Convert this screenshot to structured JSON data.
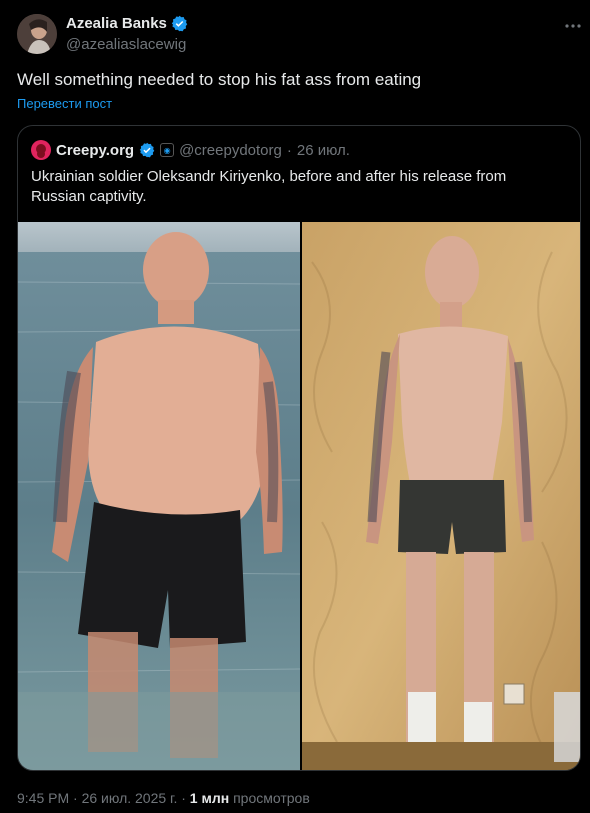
{
  "author": {
    "name": "Azealia Banks",
    "handle": "@azealiaslacewig"
  },
  "post": {
    "text": "Well something needed to stop his fat ass from eating",
    "translate_label": "Перевести пост"
  },
  "quoted": {
    "name": "Creepy.org",
    "handle": "@creepydotorg",
    "separator": "·",
    "date": "26 июл.",
    "text": "Ukrainian soldier Oleksandr Kiriyenko, before and after his release from Russian captivity."
  },
  "footer": {
    "time": "9:45 PM",
    "dot1": "·",
    "date": "26 июл. 2025 г.",
    "dot2": "·",
    "views_count": "1 млн",
    "views_label": "просмотров"
  },
  "colors": {
    "background": "#000000",
    "text": "#e7e9ea",
    "muted": "#71767b",
    "accent": "#1d9bf0",
    "border": "#2f3336"
  },
  "icons": [
    "verified-badge-icon",
    "more-options-icon",
    "affiliate-badge-icon"
  ]
}
